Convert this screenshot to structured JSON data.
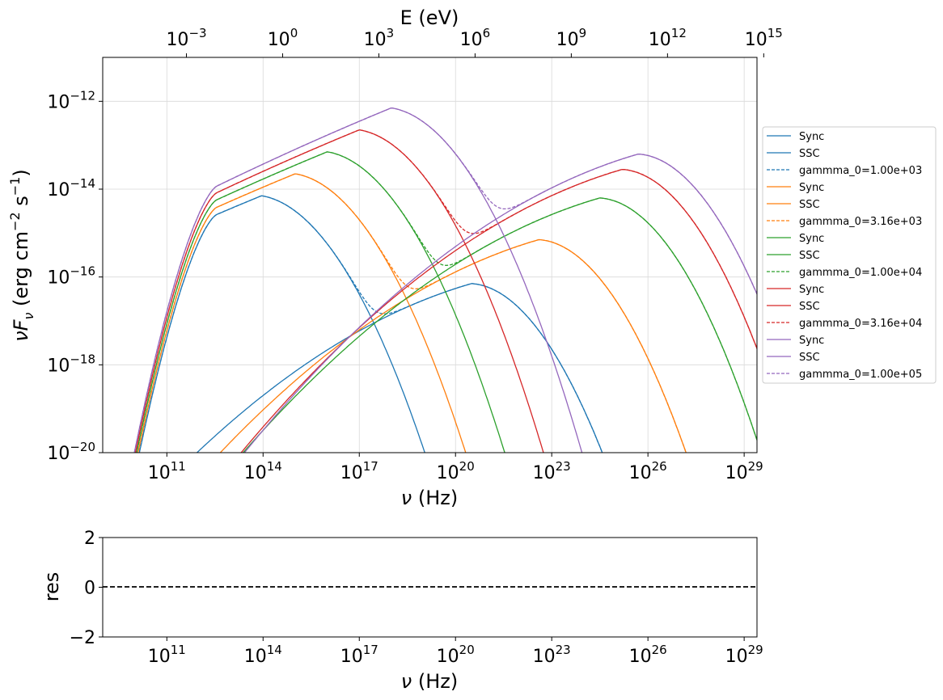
{
  "chart_data": [
    {
      "type": "line",
      "title": "",
      "xlabel": "ν  (Hz)",
      "ylabel": "νF_ν   (erg cm^-2  s^-1)",
      "x2label": "E (eV)",
      "xscale": "log",
      "yscale": "log",
      "xlim_log10": [
        9.0,
        29.4
      ],
      "ylim_log10": [
        -20.0,
        -11.0
      ],
      "x2lim_log10": [
        -5.61,
        14.79
      ],
      "grid": true,
      "legend_position": "right",
      "x_ticks": [
        {
          "log": 11,
          "label": "10^11"
        },
        {
          "log": 14,
          "label": "10^14"
        },
        {
          "log": 17,
          "label": "10^17"
        },
        {
          "log": 20,
          "label": "10^20"
        },
        {
          "log": 23,
          "label": "10^23"
        },
        {
          "log": 26,
          "label": "10^26"
        },
        {
          "log": 29,
          "label": "10^29"
        }
      ],
      "y_ticks": [
        {
          "log": -20,
          "label": "10^-20"
        },
        {
          "log": -18,
          "label": "10^-18"
        },
        {
          "log": -16,
          "label": "10^-16"
        },
        {
          "log": -14,
          "label": "10^-14"
        },
        {
          "log": -12,
          "label": "10^-12"
        }
      ],
      "x2_ticks": [
        {
          "log": -3,
          "label": "10^-3"
        },
        {
          "log": 0,
          "label": "10^0"
        },
        {
          "log": 3,
          "label": "10^3"
        },
        {
          "log": 6,
          "label": "10^6"
        },
        {
          "log": 9,
          "label": "10^9"
        },
        {
          "log": 12,
          "label": "10^12"
        },
        {
          "log": 15,
          "label": "10^15"
        }
      ],
      "series": [
        {
          "name": "Sync",
          "color": "#1f77b4",
          "style": "solid",
          "kind": "sync",
          "rise_slope": 0.3,
          "peak_log_nu": 13.95,
          "peak_log_flux": -14.15,
          "cutoff_width": 3.0
        },
        {
          "name": "SSC",
          "color": "#1f77b4",
          "style": "solid",
          "kind": "ssc",
          "peak_log_nu": 20.5,
          "peak_log_flux": -16.15,
          "rise_slope": 0.21,
          "fall_width": 2.7
        },
        {
          "name": "gammma_0=1.00e+03",
          "color": "#1f77b4",
          "style": "dashed",
          "kind": "total",
          "sum_of": [
            0,
            1
          ]
        },
        {
          "name": "Sync",
          "color": "#ff7f0e",
          "style": "solid",
          "kind": "sync",
          "rise_slope": 0.3,
          "peak_log_nu": 15.0,
          "peak_log_flux": -13.65,
          "cutoff_width": 3.0
        },
        {
          "name": "SSC",
          "color": "#ff7f0e",
          "style": "solid",
          "kind": "ssc",
          "peak_log_nu": 22.6,
          "peak_log_flux": -15.15,
          "rise_slope": 0.21,
          "fall_width": 2.7
        },
        {
          "name": "gammma_0=3.16e+03",
          "color": "#ff7f0e",
          "style": "dashed",
          "kind": "total",
          "sum_of": [
            3,
            4
          ]
        },
        {
          "name": "Sync",
          "color": "#2ca02c",
          "style": "solid",
          "kind": "sync",
          "rise_slope": 0.3,
          "peak_log_nu": 16.0,
          "peak_log_flux": -13.15,
          "cutoff_width": 3.0
        },
        {
          "name": "SSC",
          "color": "#2ca02c",
          "style": "solid",
          "kind": "ssc",
          "peak_log_nu": 24.5,
          "peak_log_flux": -14.2,
          "rise_slope": 0.21,
          "fall_width": 2.7
        },
        {
          "name": "gammma_0=1.00e+04",
          "color": "#2ca02c",
          "style": "dashed",
          "kind": "total",
          "sum_of": [
            6,
            7
          ]
        },
        {
          "name": "Sync",
          "color": "#d62728",
          "style": "solid",
          "kind": "sync",
          "rise_slope": 0.3,
          "peak_log_nu": 17.0,
          "peak_log_flux": -12.65,
          "cutoff_width": 3.0
        },
        {
          "name": "SSC",
          "color": "#d62728",
          "style": "solid",
          "kind": "ssc",
          "peak_log_nu": 25.2,
          "peak_log_flux": -13.55,
          "rise_slope": 0.21,
          "fall_width": 2.7
        },
        {
          "name": "gammma_0=3.16e+04",
          "color": "#d62728",
          "style": "dashed",
          "kind": "total",
          "sum_of": [
            9,
            10
          ]
        },
        {
          "name": "Sync",
          "color": "#9467bd",
          "style": "solid",
          "kind": "sync",
          "rise_slope": 0.3,
          "peak_log_nu": 18.0,
          "peak_log_flux": -12.15,
          "cutoff_width": 3.0
        },
        {
          "name": "SSC",
          "color": "#9467bd",
          "style": "solid",
          "kind": "ssc",
          "peak_log_nu": 25.7,
          "peak_log_flux": -13.2,
          "rise_slope": 0.21,
          "fall_width": 2.7
        },
        {
          "name": "gammma_0=1.00e+05",
          "color": "#9467bd",
          "style": "dashed",
          "kind": "total",
          "sum_of": [
            12,
            13
          ]
        }
      ]
    },
    {
      "type": "line",
      "title": "",
      "xlabel": "ν  (Hz)",
      "ylabel": "res",
      "xscale": "log",
      "xlim_log10": [
        9.0,
        29.4
      ],
      "ylim": [
        -2,
        2
      ],
      "y_ticks": [
        {
          "value": -2,
          "label": "−2"
        },
        {
          "value": 0,
          "label": "0"
        },
        {
          "value": 2,
          "label": "2"
        }
      ],
      "x_ticks": [
        {
          "log": 11,
          "label": "10^11"
        },
        {
          "log": 14,
          "label": "10^14"
        },
        {
          "log": 17,
          "label": "10^17"
        },
        {
          "log": 20,
          "label": "10^20"
        },
        {
          "log": 23,
          "label": "10^23"
        },
        {
          "log": 26,
          "label": "10^26"
        },
        {
          "log": 29,
          "label": "10^29"
        }
      ],
      "series": [
        {
          "kind": "reference-line",
          "y": 0,
          "color": "#000000",
          "style": "dashed"
        }
      ]
    }
  ]
}
